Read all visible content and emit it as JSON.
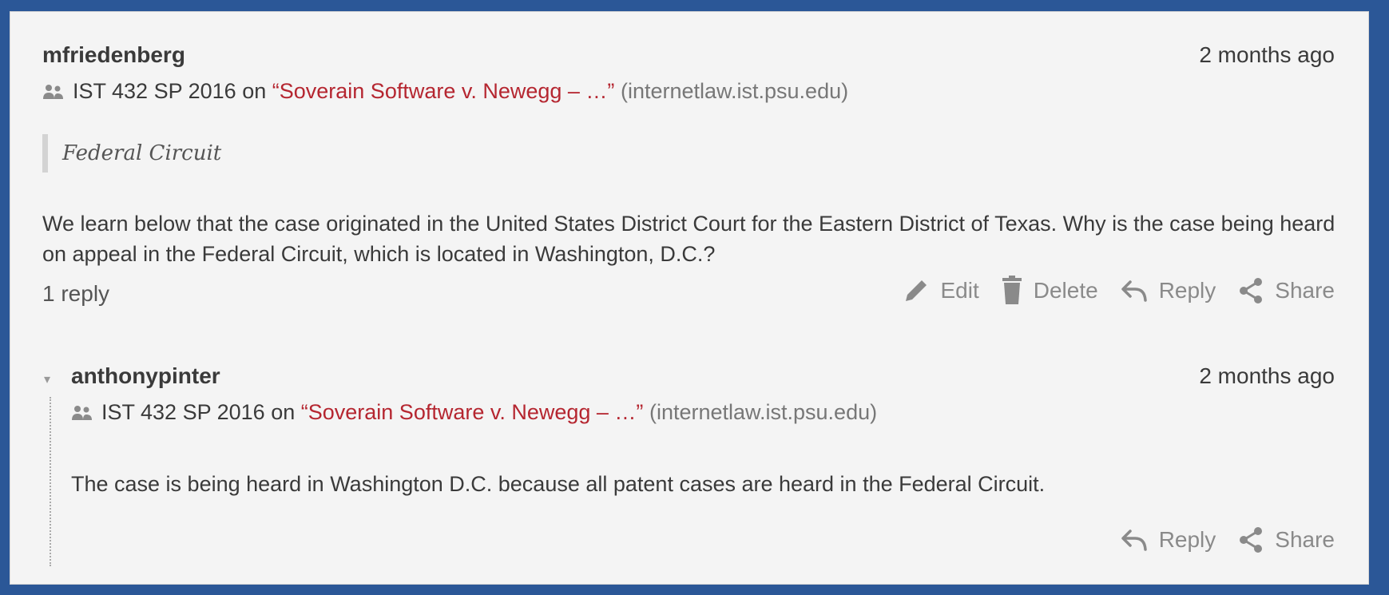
{
  "annotation": {
    "username": "mfriedenberg",
    "timestamp": "2 months ago",
    "group": "IST 432 SP 2016",
    "on_word": "on",
    "document_title": "“Soverain Software v. Newegg – …”",
    "domain": "(internetlaw.ist.psu.edu)",
    "quote": "Federal Circuit",
    "body": "We learn below that the case originated in the United States District Court for the Eastern District of Texas. Why is the case being heard on appeal in the Federal Circuit, which is located in Washington, D.C.?",
    "reply_count": "1 reply",
    "actions": {
      "edit": "Edit",
      "delete": "Delete",
      "reply": "Reply",
      "share": "Share"
    }
  },
  "reply": {
    "toggle_icon": "▾",
    "username": "anthonypinter",
    "timestamp": "2 months ago",
    "group": "IST 432 SP 2016",
    "on_word": "on",
    "document_title": "“Soverain Software v. Newegg – …”",
    "domain": "(internetlaw.ist.psu.edu)",
    "body": "The case is being heard in Washington D.C. because all patent cases are heard in the Federal Circuit.",
    "actions": {
      "reply": "Reply",
      "share": "Share"
    }
  },
  "colors": {
    "background": "#2b5797",
    "card": "#f4f4f4",
    "link": "#b52630",
    "muted": "#8a8a8a"
  }
}
